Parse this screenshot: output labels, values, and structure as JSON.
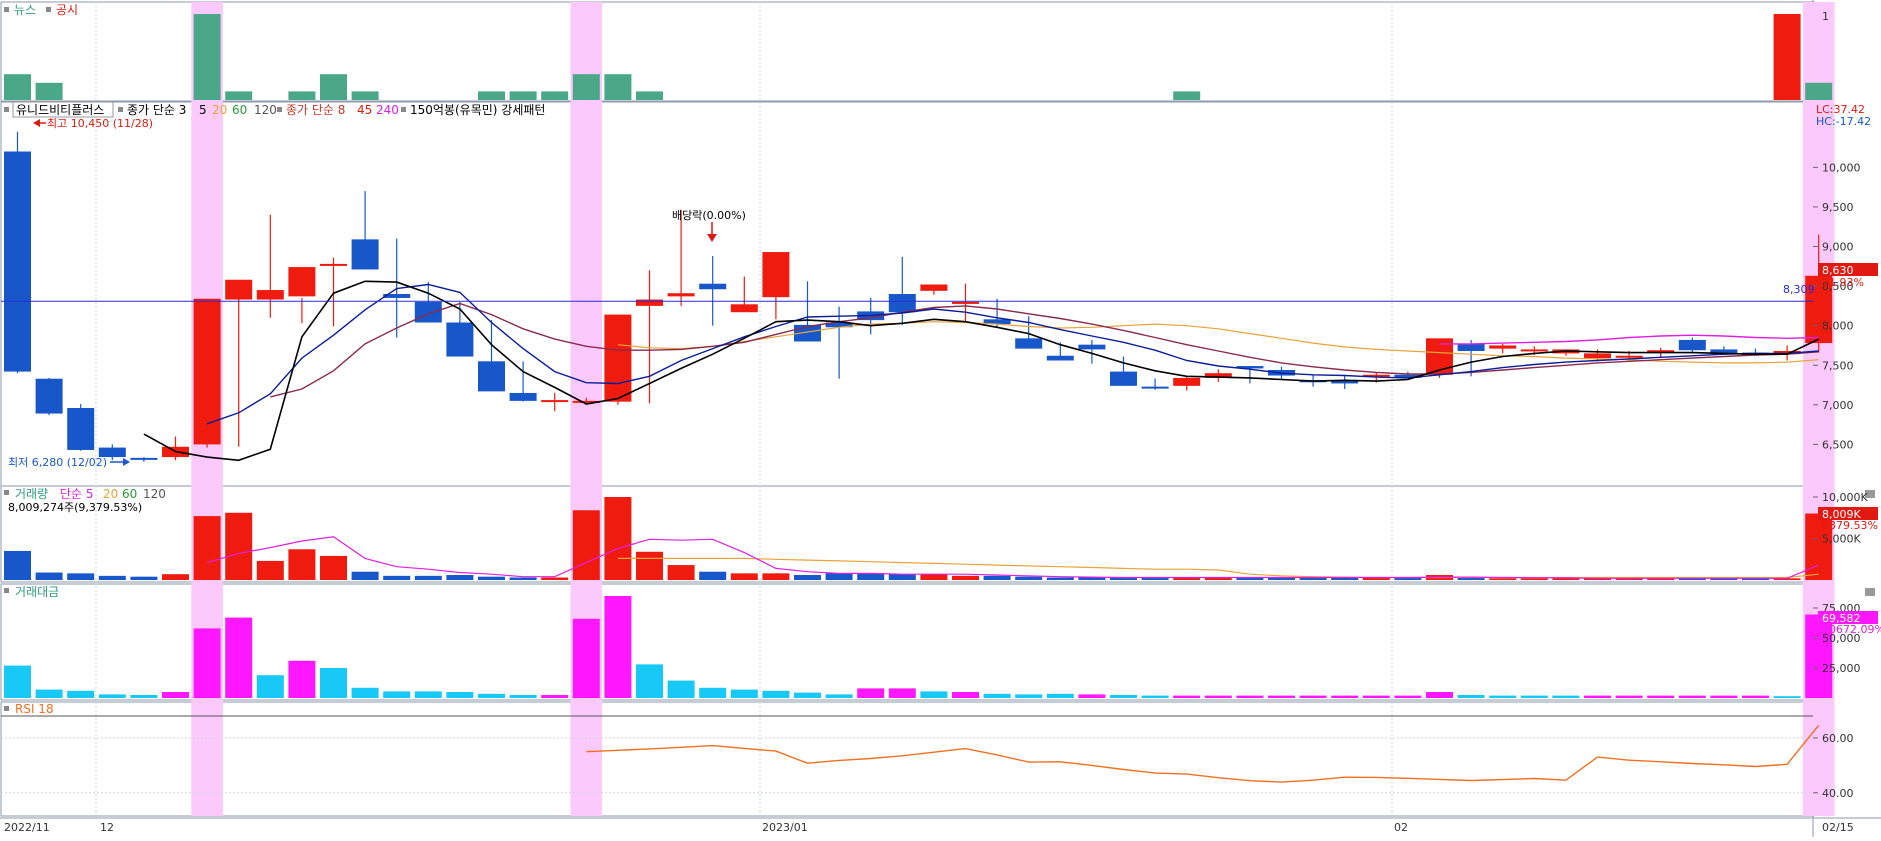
{
  "colors": {
    "up": "#ee1b0e",
    "down": "#1857c9",
    "highlight": "#fbc9fb",
    "news": "#4aa787",
    "disclosure": "#ee1b0e",
    "ma5": "#000000",
    "ma20": "#0a1d9a",
    "ma60": "#8a2a4f",
    "ma120": "#e8a33a",
    "vol_ma5": "#e020e0",
    "vol_ma20": "#e8a33a",
    "amt_up": "#ff18ff",
    "amt_down": "#18c8f6",
    "rsi": "#f07020",
    "grid": "#cfd6e0",
    "hline": "#2b2bd6"
  },
  "news_panel": {
    "label_news": "뉴스",
    "label_disclosure": "공시",
    "tick": "1"
  },
  "price_panel": {
    "stock_name": "유니드비티플러스",
    "legend_close": "종가 단순 3",
    "ma_5": "5",
    "ma_20": "20",
    "ma_60": "60",
    "ma_120": "120",
    "legend_close2": "종가 단순 8",
    "ma_45": "45",
    "ma_240": "240",
    "pattern": "150억봉(유목민) 강세패턴",
    "high_label": "최고 10,450 (11/28)",
    "low_label": "최저 6,280 (12/02)",
    "dividend_label": "배당락(0.00%)",
    "lc": "LC:37.42",
    "hc": "HC:-17.42",
    "hline_label": "8,309",
    "last_price": "8,630",
    "last_change": "11.93%"
  },
  "volume_panel": {
    "label": "거래량",
    "legend": "단순 5",
    "ma_20": "20",
    "ma_60": "60",
    "ma_120": "120",
    "current": "8,009,274주(9,379.53%)",
    "last_value": "8,009K",
    "last_pct": "9379.53%"
  },
  "amount_panel": {
    "label": "거래대금",
    "last_value": "69,582",
    "last_pct": "10672.09%"
  },
  "rsi_panel": {
    "label": "RSI 18"
  },
  "x_axis": {
    "labels": [
      "2022/11",
      "12",
      "2023/01",
      "02",
      "02/15"
    ]
  },
  "chart_data": [
    {
      "type": "bar",
      "name": "news-disclosure",
      "x": [
        0,
        1,
        2,
        3,
        4,
        5,
        6,
        7,
        8,
        9,
        10,
        11,
        12,
        13,
        14,
        15,
        16,
        17,
        18,
        19,
        20,
        21,
        22,
        23,
        24,
        25,
        26,
        27,
        28,
        29,
        30,
        31,
        32,
        33,
        34,
        35,
        36,
        37,
        38,
        39,
        40,
        41,
        42,
        43,
        44,
        45,
        46,
        47,
        48,
        49,
        50,
        51,
        52,
        53,
        54,
        55,
        56,
        57
      ],
      "news": [
        0.3,
        0.2,
        0,
        0,
        0,
        0,
        1,
        0.1,
        0,
        0.1,
        0.3,
        0.1,
        0,
        0,
        0,
        0.1,
        0.1,
        0.1,
        0.3,
        0.3,
        0.1,
        0,
        0,
        0,
        0,
        0,
        0,
        0,
        0,
        0,
        0,
        0,
        0,
        0,
        0,
        0,
        0,
        0.1,
        0,
        0,
        0,
        0,
        0,
        0,
        0,
        0,
        0,
        0,
        0,
        0,
        0,
        0,
        0,
        0,
        0,
        0,
        0,
        0.2
      ],
      "disclosure": [
        0,
        0,
        0,
        0,
        0,
        0,
        0,
        0,
        0,
        0,
        0,
        0,
        0,
        0,
        0,
        0,
        0,
        0,
        0,
        0,
        0,
        0,
        0,
        0,
        0,
        0,
        0,
        0,
        0,
        0,
        0,
        0,
        0,
        0,
        0,
        0,
        0,
        0,
        0,
        0,
        0,
        0,
        0,
        0,
        0,
        0,
        0,
        0,
        0,
        0,
        0,
        0,
        0,
        0,
        0,
        0,
        1,
        0
      ],
      "ylim": [
        0,
        1
      ]
    },
    {
      "type": "candlestick",
      "name": "price",
      "x": [
        0,
        1,
        2,
        3,
        4,
        5,
        6,
        7,
        8,
        9,
        10,
        11,
        12,
        13,
        14,
        15,
        16,
        17,
        18,
        19,
        20,
        21,
        22,
        23,
        24,
        25,
        26,
        27,
        28,
        29,
        30,
        31,
        32,
        33,
        34,
        35,
        36,
        37,
        38,
        39,
        40,
        41,
        42,
        43,
        44,
        45,
        46,
        47,
        48,
        49,
        50,
        51,
        52,
        53,
        54,
        55,
        56,
        57
      ],
      "open": [
        10200,
        7330,
        6960,
        6460,
        6330,
        6340,
        6500,
        8330,
        8330,
        8370,
        8770,
        9090,
        8400,
        8300,
        8040,
        7550,
        7150,
        7050,
        7040,
        7040,
        8250,
        8370,
        8530,
        8170,
        8360,
        8010,
        8040,
        8180,
        8400,
        8440,
        8300,
        8080,
        7840,
        7620,
        7760,
        7420,
        7230,
        7240,
        7340,
        7490,
        7440,
        7310,
        7310,
        7370,
        7380,
        7380,
        7770,
        7710,
        7700,
        7650,
        7590,
        7620,
        7680,
        7820,
        7700,
        7660,
        7640,
        7780
      ],
      "high": [
        10450,
        7340,
        7010,
        6500,
        6340,
        6600,
        6600,
        8350,
        9400,
        8350,
        8860,
        9700,
        9100,
        8550,
        8300,
        8070,
        7550,
        7150,
        7090,
        7050,
        8700,
        9460,
        8880,
        8620,
        8930,
        8560,
        8240,
        8350,
        8870,
        8520,
        8530,
        8340,
        8120,
        7790,
        7820,
        7610,
        7330,
        7360,
        7450,
        7490,
        7480,
        7380,
        7380,
        7410,
        7420,
        7510,
        7820,
        7770,
        7740,
        7700,
        7700,
        7680,
        7720,
        7850,
        7740,
        7710,
        7750,
        9150
      ],
      "low": [
        7400,
        6870,
        6420,
        6300,
        6280,
        6300,
        6460,
        6470,
        8100,
        8030,
        7990,
        8730,
        7850,
        8250,
        7940,
        7490,
        7040,
        6920,
        7030,
        7000,
        7020,
        8250,
        8000,
        8180,
        8080,
        7850,
        7330,
        7890,
        8010,
        8390,
        8050,
        7980,
        7770,
        7580,
        7520,
        7240,
        7190,
        7180,
        7290,
        7270,
        7320,
        7230,
        7200,
        7280,
        7350,
        7340,
        7360,
        7650,
        7630,
        7620,
        7550,
        7560,
        7600,
        7650,
        7650,
        7620,
        7560,
        7660
      ],
      "close": [
        7420,
        6890,
        6430,
        6340,
        6310,
        6470,
        8340,
        8580,
        8450,
        8740,
        8780,
        8710,
        8350,
        8040,
        7610,
        7170,
        7050,
        7060,
        7050,
        8140,
        8330,
        8410,
        8460,
        8270,
        8930,
        7800,
        7980,
        8070,
        8170,
        8520,
        8300,
        8020,
        7710,
        7560,
        7700,
        7240,
        7220,
        7340,
        7400,
        7460,
        7370,
        7300,
        7270,
        7380,
        7340,
        7840,
        7680,
        7750,
        7700,
        7700,
        7650,
        7620,
        7690,
        7690,
        7650,
        7630,
        7680,
        8630
      ],
      "ma5": [
        null,
        null,
        null,
        null,
        6630,
        6410,
        6340,
        6300,
        6440,
        7860,
        8410,
        8560,
        8550,
        8410,
        8210,
        7760,
        7420,
        7220,
        7010,
        7080,
        7270,
        7460,
        7640,
        7840,
        8050,
        8070,
        8050,
        8000,
        8030,
        8080,
        8050,
        7980,
        7900,
        7760,
        7650,
        7530,
        7430,
        7360,
        7350,
        7340,
        7320,
        7300,
        7310,
        7300,
        7320,
        7440,
        7540,
        7610,
        7650,
        7680,
        7670,
        7660,
        7660,
        7660,
        7650,
        7640,
        7640,
        7830
      ],
      "ma20": [
        null,
        null,
        null,
        null,
        null,
        null,
        6760,
        6900,
        7140,
        7590,
        7880,
        8200,
        8470,
        8520,
        8420,
        8040,
        7710,
        7420,
        7280,
        7270,
        7360,
        7560,
        7710,
        7860,
        7990,
        8110,
        8120,
        8130,
        8160,
        8210,
        8170,
        8100,
        8040,
        7950,
        7870,
        7790,
        7690,
        7560,
        7490,
        7450,
        7400,
        7380,
        7370,
        7350,
        7340,
        7380,
        7420,
        7470,
        7510,
        7540,
        7560,
        7580,
        7600,
        7620,
        7640,
        7650,
        7650,
        7680
      ],
      "ma60": [
        null,
        null,
        null,
        null,
        null,
        null,
        null,
        null,
        7100,
        7200,
        7430,
        7770,
        7970,
        8150,
        8280,
        8140,
        7960,
        7830,
        7740,
        7690,
        7690,
        7700,
        7740,
        7790,
        7890,
        7990,
        8050,
        8100,
        8170,
        8230,
        8250,
        8210,
        8150,
        8090,
        8020,
        7940,
        7850,
        7760,
        7680,
        7600,
        7530,
        7480,
        7440,
        7410,
        7390,
        7390,
        7410,
        7440,
        7470,
        7500,
        7530,
        7550,
        7570,
        7590,
        7610,
        7630,
        7640,
        7670
      ],
      "ma120": [
        null,
        null,
        null,
        null,
        null,
        null,
        null,
        null,
        null,
        null,
        null,
        null,
        null,
        null,
        null,
        null,
        null,
        null,
        null,
        7760,
        7720,
        7710,
        7740,
        7800,
        7860,
        7920,
        7980,
        8020,
        8030,
        8050,
        8040,
        8020,
        7990,
        7970,
        7980,
        8000,
        8020,
        8000,
        7960,
        7900,
        7840,
        7780,
        7730,
        7700,
        7680,
        7660,
        7640,
        7620,
        7610,
        7590,
        7580,
        7570,
        7550,
        7540,
        7530,
        7530,
        7540,
        7570
      ],
      "ma240": [
        null,
        null,
        null,
        null,
        null,
        null,
        null,
        null,
        null,
        null,
        null,
        null,
        null,
        null,
        null,
        null,
        null,
        null,
        null,
        null,
        null,
        null,
        null,
        null,
        null,
        null,
        null,
        null,
        null,
        null,
        null,
        null,
        null,
        null,
        null,
        null,
        null,
        null,
        null,
        null,
        null,
        null,
        null,
        null,
        null,
        7770,
        7770,
        7780,
        7790,
        7800,
        7820,
        7850,
        7870,
        7880,
        7870,
        7850,
        7840,
        7850
      ],
      "hline": 8309,
      "ylim": [
        6000,
        10800
      ],
      "yticks": [
        6500,
        7000,
        7500,
        8000,
        8500,
        9000,
        9500,
        10000
      ]
    },
    {
      "type": "bar",
      "name": "volume",
      "x": [
        0,
        1,
        2,
        3,
        4,
        5,
        6,
        7,
        8,
        9,
        10,
        11,
        12,
        13,
        14,
        15,
        16,
        17,
        18,
        19,
        20,
        21,
        22,
        23,
        24,
        25,
        26,
        27,
        28,
        29,
        30,
        31,
        32,
        33,
        34,
        35,
        36,
        37,
        38,
        39,
        40,
        41,
        42,
        43,
        44,
        45,
        46,
        47,
        48,
        49,
        50,
        51,
        52,
        53,
        54,
        55,
        56,
        57
      ],
      "values": [
        3500,
        900,
        800,
        500,
        400,
        700,
        7700,
        8100,
        2300,
        3700,
        2900,
        1000,
        500,
        500,
        600,
        400,
        300,
        300,
        8400,
        10000,
        3400,
        1800,
        1000,
        800,
        800,
        600,
        800,
        800,
        700,
        700,
        500,
        500,
        400,
        300,
        300,
        300,
        300,
        300,
        300,
        300,
        300,
        300,
        300,
        300,
        300,
        600,
        300,
        200,
        200,
        200,
        200,
        200,
        200,
        200,
        200,
        200,
        200,
        8009
      ],
      "ma5": [
        null,
        null,
        null,
        null,
        1220,
        null,
        2100,
        3200,
        3900,
        4700,
        5200,
        2600,
        1600,
        1300,
        900,
        700,
        400,
        400,
        2100,
        3800,
        4900,
        4800,
        4900,
        3300,
        1400,
        1000,
        800,
        800,
        700,
        700,
        700,
        600,
        500,
        400,
        350,
        300,
        300,
        300,
        300,
        300,
        300,
        300,
        300,
        300,
        300,
        350,
        350,
        300,
        280,
        250,
        200,
        200,
        200,
        200,
        200,
        200,
        200,
        1800
      ],
      "ma20": [
        null,
        null,
        null,
        null,
        null,
        null,
        null,
        null,
        null,
        null,
        null,
        null,
        null,
        null,
        null,
        null,
        null,
        null,
        null,
        2600,
        2600,
        2600,
        2600,
        2600,
        2500,
        2400,
        2300,
        2200,
        2100,
        2000,
        1900,
        1800,
        1700,
        1600,
        1500,
        1400,
        1300,
        1300,
        1200,
        700,
        500,
        400,
        350,
        300,
        300,
        300,
        300,
        300,
        300,
        300,
        300,
        300,
        300,
        300,
        300,
        300,
        300,
        700
      ],
      "yticks": [
        5000,
        10000
      ],
      "ylim": [
        0,
        10000
      ]
    },
    {
      "type": "bar",
      "name": "trading-amount",
      "x": [
        0,
        1,
        2,
        3,
        4,
        5,
        6,
        7,
        8,
        9,
        10,
        11,
        12,
        13,
        14,
        15,
        16,
        17,
        18,
        19,
        20,
        21,
        22,
        23,
        24,
        25,
        26,
        27,
        28,
        29,
        30,
        31,
        32,
        33,
        34,
        35,
        36,
        37,
        38,
        39,
        40,
        41,
        42,
        43,
        44,
        45,
        46,
        47,
        48,
        49,
        50,
        51,
        52,
        53,
        54,
        55,
        56,
        57
      ],
      "values": [
        27000,
        7000,
        6000,
        3000,
        2500,
        5000,
        58000,
        67000,
        19000,
        31000,
        25000,
        8500,
        5500,
        5500,
        5000,
        3500,
        2500,
        2500,
        66000,
        85000,
        28000,
        14500,
        8500,
        7000,
        6000,
        4500,
        3000,
        8000,
        8000,
        5500,
        5000,
        3500,
        3000,
        3500,
        3000,
        2500,
        2000,
        2000,
        2000,
        2000,
        2000,
        2000,
        2000,
        2000,
        2000,
        5000,
        2500,
        2000,
        2000,
        2000,
        2000,
        2000,
        2000,
        2000,
        2000,
        2000,
        1500,
        69582
      ],
      "up": [
        false,
        false,
        false,
        false,
        false,
        true,
        true,
        true,
        false,
        true,
        false,
        false,
        false,
        false,
        false,
        false,
        false,
        true,
        true,
        true,
        false,
        false,
        false,
        false,
        false,
        false,
        false,
        true,
        true,
        false,
        true,
        false,
        false,
        false,
        true,
        false,
        false,
        true,
        true,
        true,
        true,
        true,
        true,
        true,
        true,
        true,
        false,
        false,
        false,
        false,
        true,
        true,
        true,
        true,
        true,
        true,
        false,
        true
      ],
      "yticks": [
        25000,
        50000,
        75000
      ],
      "ylim": [
        0,
        85000
      ]
    },
    {
      "type": "line",
      "name": "rsi",
      "x": [
        18,
        19,
        20,
        21,
        22,
        23,
        24,
        25,
        26,
        27,
        28,
        29,
        30,
        31,
        32,
        33,
        34,
        35,
        36,
        37,
        38,
        39,
        40,
        41,
        42,
        43,
        44,
        45,
        46,
        47,
        48,
        49,
        50,
        51,
        52,
        53,
        54,
        55,
        56,
        57
      ],
      "values": [
        55,
        55.5,
        56,
        56.6,
        57.2,
        56.2,
        55.2,
        50.8,
        51.8,
        52.5,
        53.5,
        54.8,
        56.1,
        53.8,
        51.2,
        51.3,
        50,
        48.5,
        47.2,
        46.8,
        45.5,
        44.4,
        43.9,
        44.6,
        45.7,
        45.6,
        45.3,
        44.9,
        44.5,
        44.8,
        45.2,
        44.6,
        53,
        51.9,
        51.3,
        50.7,
        50.2,
        49.6,
        50.4,
        64.6
      ],
      "yticks": [
        40,
        60
      ],
      "ylim": [
        33,
        68
      ]
    }
  ]
}
